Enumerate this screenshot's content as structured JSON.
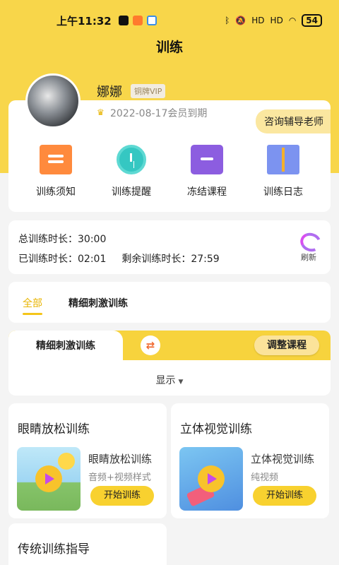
{
  "status_bar": {
    "time": "上午11:32",
    "network_1": "HD",
    "network_2": "HD",
    "battery": "54"
  },
  "header": {
    "title": "训练"
  },
  "profile": {
    "name": "娜娜",
    "vip_level": "铜牌VIP",
    "expire_text": "2022-08-17会员到期",
    "consult_button": "咨询辅导老师"
  },
  "shortcuts": [
    {
      "label": "训练须知",
      "icon": "notice-board-icon"
    },
    {
      "label": "训练提醒",
      "icon": "alarm-clock-icon"
    },
    {
      "label": "冻结课程",
      "icon": "archive-box-icon"
    },
    {
      "label": "训练日志",
      "icon": "book-icon"
    }
  ],
  "training_time": {
    "total_label": "总训练时长：",
    "total_value": "30:00",
    "done_label": "已训练时长：",
    "done_value": "02:01",
    "remaining_label": "剩余训练时长：",
    "remaining_value": "27:59",
    "refresh_label": "刷新"
  },
  "filter_tabs": [
    "全部",
    "精细刺激训练"
  ],
  "course": {
    "current_tab": "精细刺激训练",
    "adjust_button": "调整课程",
    "display_label": "显示"
  },
  "trainings": [
    {
      "title": "眼睛放松训练",
      "item_name": "眼睛放松训练",
      "item_type": "音频+视频样式",
      "button": "开始训练"
    },
    {
      "title": "立体视觉训练",
      "item_name": "立体视觉训练",
      "item_type": "纯视频",
      "button": "开始训练"
    }
  ],
  "guide": {
    "title": "传统训练指导"
  },
  "colors": {
    "brand_yellow": "#f8d64a",
    "accent_yellow": "#f4c51a",
    "button_yellow": "#f8d12f"
  }
}
